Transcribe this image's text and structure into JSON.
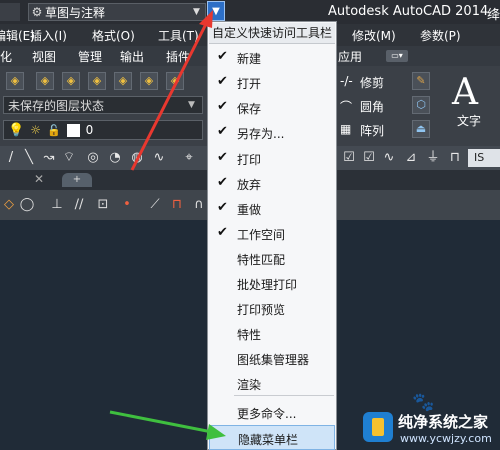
{
  "titlebar": {
    "workspace": "草图与注释",
    "app_title": "Autodesk AutoCAD 2014",
    "right_text": "绛"
  },
  "menubar": {
    "items": [
      "编辑(E)",
      "插入(I)",
      "格式(O)",
      "工具(T)",
      "修改(M)",
      "参数(P)"
    ]
  },
  "ribbon_tabs": {
    "items": [
      "化",
      "视图",
      "管理",
      "输出",
      "插件",
      "应用"
    ]
  },
  "ribbon": {
    "layer_state": "未保存的图层状态",
    "layer_value": "0",
    "modify_labels": [
      "修剪",
      "圆角",
      "阵列"
    ],
    "text_icon": "A",
    "text_label": "文字"
  },
  "toolbar2": {
    "badge": "IS"
  },
  "dropdown": {
    "header": "自定义快速访问工具栏",
    "items": [
      {
        "label": "新建",
        "checked": "✔"
      },
      {
        "label": "打开",
        "checked": "✔"
      },
      {
        "label": "保存",
        "checked": "✔"
      },
      {
        "label": "另存为...",
        "checked": "✔"
      },
      {
        "label": "打印",
        "checked": "✔"
      },
      {
        "label": "放弃",
        "checked": "✔"
      },
      {
        "label": "重做",
        "checked": "✔"
      },
      {
        "label": "工作空间",
        "checked": "✔"
      },
      {
        "label": "特性匹配",
        "checked": ""
      },
      {
        "label": "批处理打印",
        "checked": ""
      },
      {
        "label": "打印预览",
        "checked": ""
      },
      {
        "label": "特性",
        "checked": ""
      },
      {
        "label": "图纸集管理器",
        "checked": ""
      },
      {
        "label": "渲染",
        "checked": ""
      }
    ],
    "more_commands": "更多命令...",
    "hide_menubar": "隐藏菜单栏"
  },
  "watermark": {
    "title": "纯净系统之家",
    "url": "www.ycwjzy.com"
  },
  "colors": {
    "red_arrow": "#e8382f",
    "green_arrow": "#3fbf3f",
    "highlight": "#cfe4f8"
  }
}
